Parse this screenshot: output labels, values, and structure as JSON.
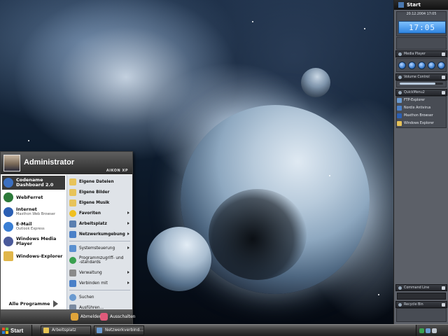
{
  "start_menu": {
    "user": "Administrator",
    "brand": "AIKON XP",
    "pinned": [
      {
        "title": "Codename Dashboard 2.0",
        "subtitle": "",
        "icon": "globe-icon",
        "color": "#3b6fc0"
      },
      {
        "title": "WebFerret",
        "subtitle": "",
        "icon": "ferret-icon",
        "color": "#2c7a3a"
      },
      {
        "title": "Internet",
        "subtitle": "Maxthon Web Browser",
        "icon": "browser-icon",
        "color": "#2b5fb3"
      },
      {
        "title": "E-Mail",
        "subtitle": "Outlook Express",
        "icon": "mail-icon",
        "color": "#3a7fd4"
      },
      {
        "title": "Windows Media Player",
        "subtitle": "",
        "icon": "media-player-icon",
        "color": "#4a5a9a"
      },
      {
        "title": "Windows-Explorer",
        "subtitle": "",
        "icon": "folder-icon",
        "color": "#e0b64a"
      }
    ],
    "all_programs": "Alle Programme",
    "places": [
      {
        "label": "Eigene Dateien",
        "icon": "folder-icon",
        "color": "#e7c35a",
        "submenu": false,
        "bold": true
      },
      {
        "label": "Eigene Bilder",
        "icon": "folder-icon",
        "color": "#e7c35a",
        "submenu": false,
        "bold": true
      },
      {
        "label": "Eigene Musik",
        "icon": "folder-icon",
        "color": "#e7c35a",
        "submenu": false,
        "bold": true
      },
      {
        "label": "Favoriten",
        "icon": "star-icon",
        "color": "#f0c020",
        "submenu": true,
        "bold": true
      },
      {
        "label": "Arbeitsplatz",
        "icon": "computer-icon",
        "color": "#5a7fb0",
        "submenu": true,
        "bold": true
      },
      {
        "label": "Netzwerkumgebung",
        "icon": "network-icon",
        "color": "#4a80c8",
        "submenu": true,
        "bold": true
      }
    ],
    "system": [
      {
        "label": "Systemsteuerung",
        "icon": "control-panel-icon",
        "color": "#5a90d0",
        "submenu": true
      },
      {
        "label": "Programmzugriff- und -standards",
        "icon": "defaults-icon",
        "color": "#3aa050",
        "submenu": false
      },
      {
        "label": "Verwaltung",
        "icon": "admin-tools-icon",
        "color": "#8a8a8a",
        "submenu": true
      },
      {
        "label": "Verbinden mit",
        "icon": "connect-icon",
        "color": "#4a80c8",
        "submenu": true
      }
    ],
    "tools": [
      {
        "label": "Suchen",
        "icon": "search-icon",
        "color": "#6a9ad0"
      },
      {
        "label": "Ausführen...",
        "icon": "run-icon",
        "color": "#7a8aa0"
      }
    ],
    "logoff": "Abmelden",
    "shutdown": "Ausschalten"
  },
  "taskbar": {
    "start_label": "Start",
    "tasks": [
      "Arbeitsplatz",
      "Netzwerkverbind..."
    ]
  },
  "sidebar": {
    "start_label": "Start",
    "date": "20.12.2004 17:05",
    "time": "17:05",
    "player_title": "Media Player",
    "volume_title": "Volume Control",
    "volume_level": 0.82,
    "quicklinks_title": "QuickMenu2",
    "quicklinks": [
      {
        "label": "FTP-Explorer",
        "color": "#6a9ad0"
      },
      {
        "label": "Nordix Antivirus",
        "color": "#4a80c8"
      },
      {
        "label": "Maxthon Browser",
        "color": "#2b5fb3"
      },
      {
        "label": "Windows Explorer",
        "color": "#e7c35a"
      }
    ],
    "command_title": "Command Line",
    "recycle_title": "Recycle Bin"
  }
}
